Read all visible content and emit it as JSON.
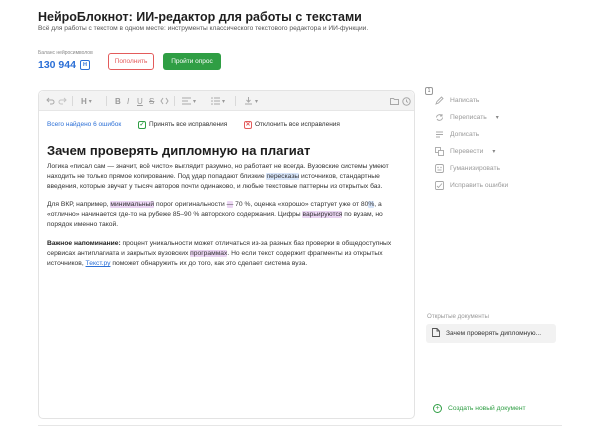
{
  "header": {
    "title": "НейроБлокнот: ИИ-редактор для работы с текстами",
    "subtitle": "Всё для работы с текстом в одном месте: инструменты классического текстового редактора и ИИ-функции."
  },
  "balance": {
    "label": "Баланс нейросимволов",
    "value": "130 944",
    "icon": "coin-icon",
    "icon_glyph": "Н"
  },
  "buttons": {
    "topup": "Пополнить",
    "survey": "Пройти опрос"
  },
  "toolbar": {
    "heading_glyph": "H",
    "chevron": "▾",
    "bold": "B",
    "italic": "I",
    "underline": "U",
    "strike": "S"
  },
  "errors": {
    "count_text": "Всего найдено 6 ошибок",
    "accept_all": "Принять все исправления",
    "reject_all": "Отклонить все исправления",
    "accept_glyph": "✓",
    "reject_glyph": "✕"
  },
  "document": {
    "title": "Зачем проверять дипломную на плагиат",
    "p1": {
      "a": "Логика «писал сам — значит, всё чисто» выглядит разумно, но работает не всегда. Вузовские системы умеют находить не только прямое копирование. Под удар попадают близкие ",
      "hl1": "пересказы",
      "b": " источников, стандартные введения, которые звучат у тысяч авторов почти одинаково, и любые текстовые паттерны из открытых баз."
    },
    "p2": {
      "a": "Для ВКР, например, ",
      "hl1": "минимальный",
      "b": " порог оригинальности ",
      "hl2": "—",
      "c": " 70 %, оценка «хорошо» стартует уже от 80",
      "hl3": "%",
      "d": ", а «отлично» начинается где-то на рубеже 85–90 % авторского содержания. Цифры ",
      "hl4": "варьируются",
      "e": " по вузам, но порядок именно такой."
    },
    "p3": {
      "bold": "Важное напоминание:",
      "a": " процент уникальности может отличаться из-за разных баз проверки в общедоступных сервисах антиплагиата и закрытых вузовских ",
      "hl1": "программах",
      "b": ". Но если текст содержит фрагменты из открытых источников, ",
      "link": "Текст.ру",
      "c": " поможет обнаружить их до того, как это сделает система вуза."
    }
  },
  "sidebar": {
    "badge": "1",
    "items": [
      {
        "label": "Написать",
        "icon": "pencil-icon"
      },
      {
        "label": "Переписать",
        "icon": "rewrite-icon",
        "chevron": "▾"
      },
      {
        "label": "Дописать",
        "icon": "continue-icon"
      },
      {
        "label": "Перевести",
        "icon": "translate-icon",
        "chevron": "▾"
      },
      {
        "label": "Гуманизировать",
        "icon": "humanize-icon"
      },
      {
        "label": "Исправить ошибки",
        "icon": "fix-errors-icon"
      }
    ],
    "opened_label": "Открытые документы",
    "opened_doc": "Зачем проверять дипломную...",
    "create_doc": "Создать новый документ",
    "create_glyph": "+"
  }
}
